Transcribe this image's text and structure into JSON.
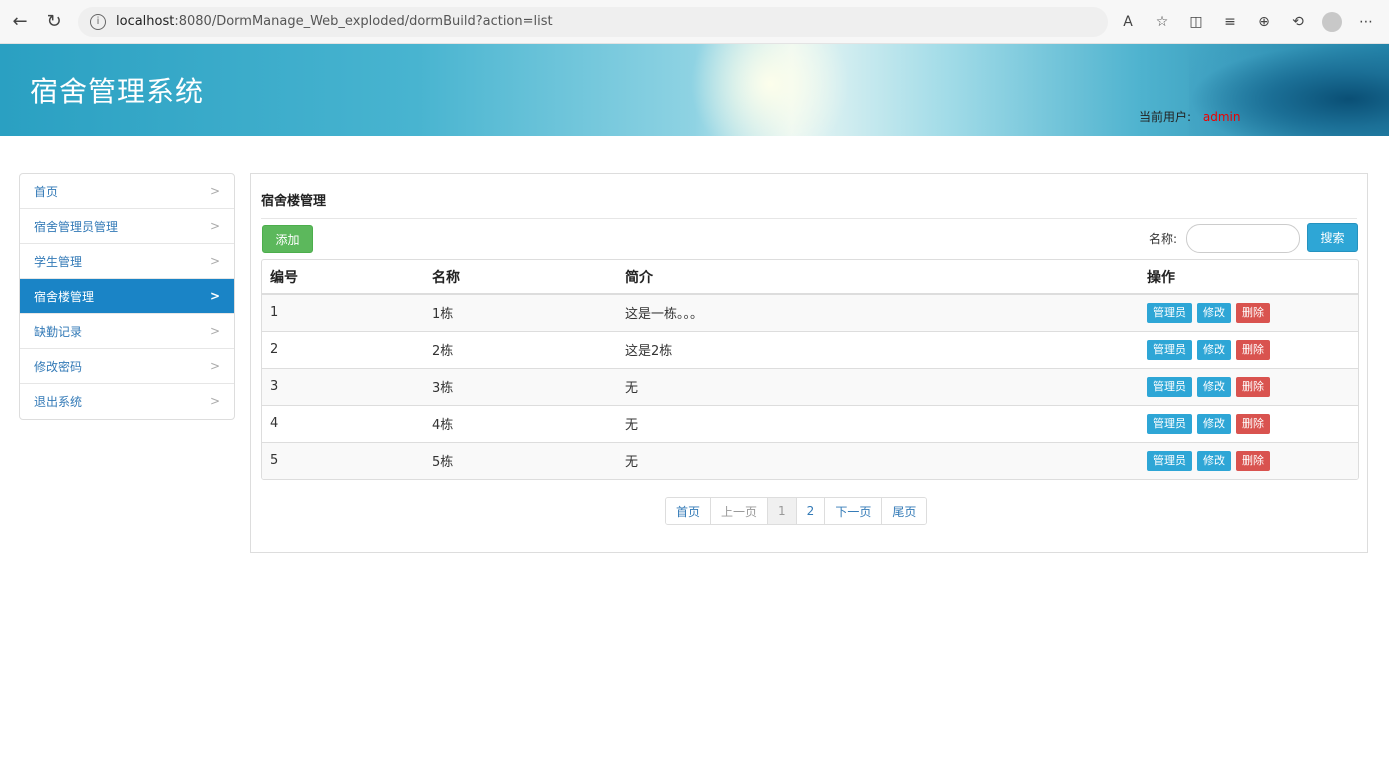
{
  "browser": {
    "url_host": "localhost",
    "url_rest": ":8080/DormManage_Web_exploded/dormBuild?action=list",
    "icons": [
      "back-icon",
      "refresh-icon",
      "info-icon",
      "read-aloud-icon",
      "favorite-add-icon",
      "split-screen-icon",
      "favorites-icon",
      "collections-icon",
      "history-icon",
      "profile-icon",
      "more-icon"
    ]
  },
  "header": {
    "title": "宿舍管理系统",
    "user_label": "当前用户:",
    "user_name": "admin"
  },
  "sidebar": {
    "items": [
      {
        "label": "首页"
      },
      {
        "label": "宿舍管理员管理"
      },
      {
        "label": "学生管理"
      },
      {
        "label": "宿舍楼管理",
        "active": true
      },
      {
        "label": "缺勤记录"
      },
      {
        "label": "修改密码"
      },
      {
        "label": "退出系统"
      }
    ]
  },
  "main": {
    "title": "宿舍楼管理",
    "add_label": "添加",
    "search_label": "名称:",
    "search_value": "",
    "search_button": "搜索",
    "table": {
      "headers": [
        "编号",
        "名称",
        "简介",
        "操作"
      ],
      "rows": [
        {
          "id": "1",
          "name": "1栋",
          "desc": "这是一栋。。。"
        },
        {
          "id": "2",
          "name": "2栋",
          "desc": "这是2栋"
        },
        {
          "id": "3",
          "name": "3栋",
          "desc": "无"
        },
        {
          "id": "4",
          "name": "4栋",
          "desc": "无"
        },
        {
          "id": "5",
          "name": "5栋",
          "desc": "无"
        }
      ],
      "actions": {
        "manager": "管理员",
        "edit": "修改",
        "delete": "删除"
      }
    },
    "pagination": {
      "first": "首页",
      "prev": "上一页",
      "pages": [
        "1",
        "2"
      ],
      "current": "1",
      "next": "下一页",
      "last": "尾页"
    }
  },
  "colors": {
    "active_nav": "#1a84c6",
    "add_button": "#5cb85c",
    "search_button": "#2ea6d6",
    "delete_button": "#d9534f",
    "user_name": "#ee0000"
  }
}
